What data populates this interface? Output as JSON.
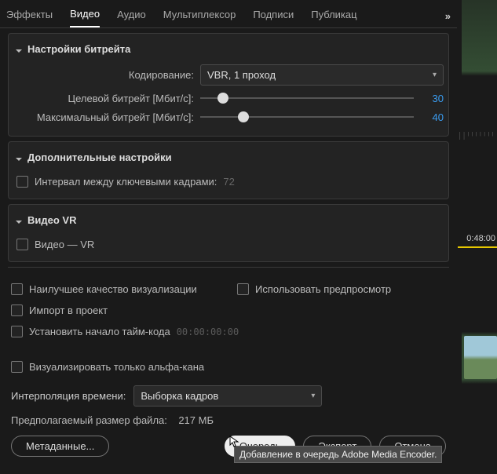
{
  "tabs": {
    "items": [
      "Эффекты",
      "Видео",
      "Аудио",
      "Мультиплексор",
      "Подписи",
      "Публикац"
    ],
    "active_index": 1,
    "overflow": "»"
  },
  "bitrate": {
    "title": "Настройки битрейта",
    "encoding_label": "Кодирование:",
    "encoding_value": "VBR, 1 проход",
    "target_label": "Целевой битрейт [Мбит/с]:",
    "target_value": "30",
    "max_label": "Максимальный битрейт [Мбит/с]:",
    "max_value": "40"
  },
  "advanced": {
    "title": "Дополнительные настройки",
    "keyframe_label": "Интервал между ключевыми кадрами:",
    "keyframe_value": "72"
  },
  "vr": {
    "title": "Видео VR",
    "checkbox_label": "Видео — VR"
  },
  "bottom": {
    "best_quality": "Наилучшее качество визуализации",
    "use_preview": "Использовать предпросмотр",
    "import_project": "Импорт в проект",
    "set_tc_start": "Установить начало тайм-кода",
    "tc_value": "00:00:00:00",
    "alpha_only": "Визуализировать только альфа-кана",
    "interp_label": "Интерполяция времени:",
    "interp_value": "Выборка кадров",
    "est_size_label": "Предполагаемый размер файла:",
    "est_size_value": "217 МБ"
  },
  "buttons": {
    "metadata": "Метаданные...",
    "queue": "Очередь",
    "export": "Экспорт",
    "cancel": "Отмена"
  },
  "tooltip": "Добавление в очередь Adobe Media Encoder.",
  "timeline": {
    "time": "0:48:00"
  }
}
